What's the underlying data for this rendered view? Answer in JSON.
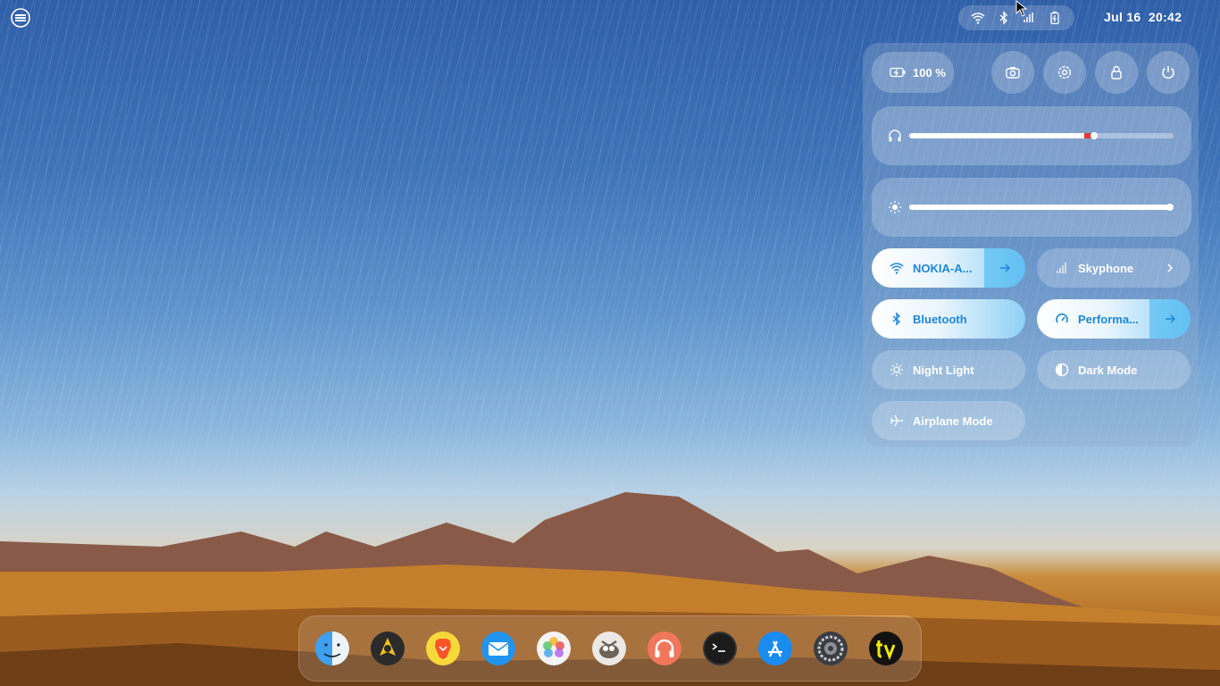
{
  "topbar": {
    "date": "Jul 16",
    "time": "20:42",
    "tray_icons": [
      "wifi-icon",
      "bluetooth-icon",
      "signal-icon",
      "battery-icon"
    ]
  },
  "quick_settings": {
    "battery_label": "100 %",
    "battery_level": 1.0,
    "volume_level": 0.7,
    "brightness_level": 1.0,
    "toggles": [
      {
        "label": "NOKIA-A...",
        "icon": "wifi-icon",
        "on": true,
        "has_arrow": true
      },
      {
        "label": "Skyphone",
        "icon": "signal-icon",
        "on": false,
        "has_arrow": true
      },
      {
        "label": "Bluetooth",
        "icon": "bluetooth-icon",
        "on": true,
        "has_arrow": false
      },
      {
        "label": "Performa...",
        "icon": "performance-icon",
        "on": true,
        "has_arrow": true
      },
      {
        "label": "Night Light",
        "icon": "night-light-icon",
        "on": false,
        "has_arrow": false
      },
      {
        "label": "Dark Mode",
        "icon": "dark-mode-icon",
        "on": false,
        "has_arrow": false
      },
      {
        "label": "Airplane Mode",
        "icon": "airplane-icon",
        "on": false,
        "has_arrow": false
      }
    ],
    "buttons": [
      "screenshot-icon",
      "settings-icon",
      "lock-icon",
      "power-icon"
    ]
  },
  "dock": {
    "apps": [
      "finder",
      "cursor-app",
      "brave-browser",
      "mail",
      "photos",
      "gimp",
      "music",
      "terminal",
      "app-store",
      "system-settings",
      "tv"
    ]
  },
  "colors": {
    "accent": "#1c86d8",
    "toggle_on_gradient_end": "#8fd0f5",
    "volume_overamp": "#e53935"
  }
}
